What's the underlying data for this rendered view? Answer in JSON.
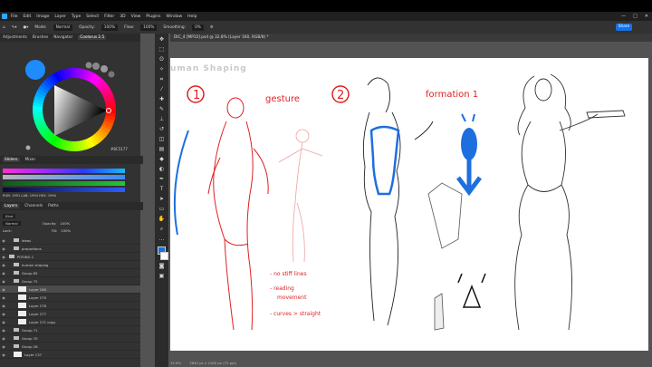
{
  "menu": [
    "File",
    "Edit",
    "Image",
    "Layer",
    "Type",
    "Select",
    "Filter",
    "3D",
    "View",
    "Plugins",
    "Window",
    "Help"
  ],
  "window_controls": [
    "—",
    "□",
    "✕"
  ],
  "options_bar": {
    "mode_label": "Mode:",
    "mode_value": "Normal",
    "opacity_label": "Opacity:",
    "opacity_value": "100%",
    "flow_label": "Flow:",
    "flow_value": "100%",
    "smoothing_label": "Smoothing:",
    "smoothing_value": "0%",
    "share": "Share"
  },
  "left_tabs": [
    "Adjustments",
    "Brushes",
    "Navigator",
    "Coolorus 2.5"
  ],
  "color_hex": "#8C5177",
  "color_readout": "RGB: 1991 LAB: 1994 HEX: 1994",
  "slider_tabs": [
    "Sliders",
    "Mixer"
  ],
  "layer_tabs": [
    "Layers",
    "Channels",
    "Paths"
  ],
  "layer_controls": {
    "kind": "Kind",
    "blend": "Normal",
    "opacity_label": "Opacity:",
    "opacity": "100%",
    "lock_label": "Lock:",
    "fill_label": "Fill:",
    "fill": "100%"
  },
  "layers": [
    {
      "name": "ideas",
      "type": "folder",
      "indent": 1
    },
    {
      "name": "proportions",
      "type": "folder",
      "indent": 1
    },
    {
      "name": "POSING 1",
      "type": "folder",
      "indent": 0
    },
    {
      "name": "human shaping",
      "type": "folder",
      "indent": 1
    },
    {
      "name": "Group 65",
      "type": "folder",
      "indent": 1
    },
    {
      "name": "Group 72",
      "type": "folder",
      "indent": 1
    },
    {
      "name": "Layer 160",
      "type": "layer",
      "indent": 2,
      "selected": true
    },
    {
      "name": "Layer 270",
      "type": "layer",
      "indent": 2
    },
    {
      "name": "Layer 278",
      "type": "layer",
      "indent": 2
    },
    {
      "name": "Layer 277",
      "type": "layer",
      "indent": 2
    },
    {
      "name": "Layer 271 copy",
      "type": "layer",
      "indent": 2
    },
    {
      "name": "Group 71",
      "type": "folder",
      "indent": 1
    },
    {
      "name": "Group 70",
      "type": "folder",
      "indent": 1
    },
    {
      "name": "Group 26",
      "type": "folder",
      "indent": 1
    },
    {
      "name": "Layer 137",
      "type": "layer",
      "indent": 1
    }
  ],
  "doc_tab": "DIC_4 [MP10].psd @ 32.8% (Layer 160, RGB/8) *",
  "canvas": {
    "heading": "uman Shaping",
    "num1": "1",
    "gesture": "gesture",
    "num2": "2",
    "formation": "formation 1",
    "note1": "- no stiff lines",
    "note2": "- reading",
    "note3": "movement",
    "note4": "- curves > straight"
  },
  "status": {
    "zoom": "32.8%",
    "doc_size": "3840 px x 2160 px (72 ppi)"
  },
  "colors": {
    "accent": "#1473e6",
    "red_ink": "#e02020",
    "blue_ink": "#1d6fe0"
  }
}
